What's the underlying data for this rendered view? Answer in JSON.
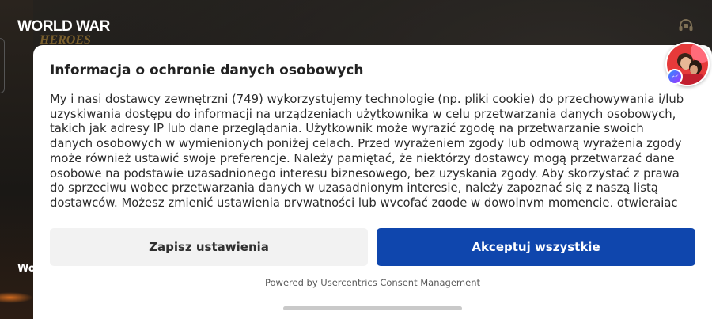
{
  "background": {
    "logo": {
      "line1": "WORLD WAR",
      "line2": "HEROES"
    },
    "side_label": "Wo",
    "support_icon": "headset-icon"
  },
  "consent": {
    "title": "Informacja o ochronie danych osobowych",
    "body": "My i nasi dostawcy zewnętrzni (749) wykorzystujemy technologie (np. pliki cookie) do przechowywania i/lub uzyskiwania dostępu do informacji na urządzeniach użytkownika w celu przetwarzania danych osobowych, takich jak adresy IP lub dane przeglądania. Użytkownik może wyrazić zgodę na przetwarzanie swoich danych osobowych w wymienionych poniżej celach. Przed wyrażeniem zgody lub odmową wyrażenia zgody może również ustawić swoje preferencje. Należy pamiętać, że niektórzy dostawcy mogą przetwarzać dane osobowe na podstawie uzasadnionego interesu biznesowego, bez uzyskania zgody. Aby skorzystać z prawa do sprzeciwu wobec przetwarzania danych w uzasadnionym interesie, należy zapoznać się z naszą listą dostawców. Możesz zmienić ustawienia prywatności lub wycofać zgodę w dowolnym momencie, otwierając",
    "save_label": "Zapisz ustawienia",
    "accept_label": "Akceptuj wszystkie",
    "powered_by": "Powered by Usercentrics Consent Management",
    "accent_color": "#0f46ad"
  },
  "chat": {
    "avatar_icon": "chat-avatar",
    "badge_icon": "messenger-icon"
  }
}
